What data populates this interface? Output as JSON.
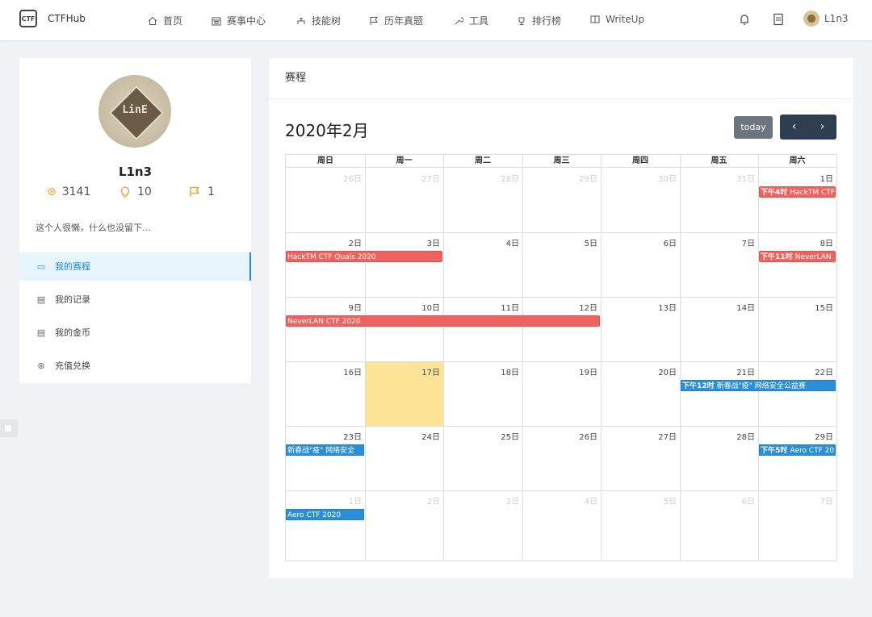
{
  "nav": {
    "brand": "CTFHub",
    "items": [
      {
        "label": "首页",
        "icon": "home-icon"
      },
      {
        "label": "赛事中心",
        "icon": "calendar-icon"
      },
      {
        "label": "技能树",
        "icon": "tree-icon"
      },
      {
        "label": "历年真题",
        "icon": "flag-icon"
      },
      {
        "label": "工具",
        "icon": "wrench-icon"
      },
      {
        "label": "排行榜",
        "icon": "trophy-icon"
      },
      {
        "label": "WriteUp",
        "icon": "book-icon"
      }
    ],
    "user_name": "L1n3"
  },
  "profile": {
    "avatar_text": "LinE",
    "name": "L1n3",
    "coins": "3141",
    "hints": "10",
    "flags": "1",
    "bio": "这个人很懒，什么也没留下...",
    "menu": [
      {
        "label": "我的赛程",
        "icon": "calendar-icon",
        "active": true
      },
      {
        "label": "我的记录",
        "icon": "record-icon",
        "active": false
      },
      {
        "label": "我的金币",
        "icon": "coin-record-icon",
        "active": false
      },
      {
        "label": "充值兑换",
        "icon": "exchange-icon",
        "active": false
      }
    ]
  },
  "schedule": {
    "panel_title": "赛程",
    "month_title": "2020年2月",
    "today_label": "today",
    "prev_label": "‹",
    "next_label": "›",
    "weekdays": [
      "周日",
      "周一",
      "周二",
      "周三",
      "周四",
      "周五",
      "周六"
    ],
    "weeks": [
      [
        {
          "d": "26日",
          "o": true
        },
        {
          "d": "27日",
          "o": true
        },
        {
          "d": "28日",
          "o": true
        },
        {
          "d": "29日",
          "o": true
        },
        {
          "d": "30日",
          "o": true
        },
        {
          "d": "31日",
          "o": true
        },
        {
          "d": "1日",
          "o": false
        }
      ],
      [
        {
          "d": "2日",
          "o": false
        },
        {
          "d": "3日",
          "o": false
        },
        {
          "d": "4日",
          "o": false
        },
        {
          "d": "5日",
          "o": false
        },
        {
          "d": "6日",
          "o": false
        },
        {
          "d": "7日",
          "o": false
        },
        {
          "d": "8日",
          "o": false
        }
      ],
      [
        {
          "d": "9日",
          "o": false
        },
        {
          "d": "10日",
          "o": false
        },
        {
          "d": "11日",
          "o": false
        },
        {
          "d": "12日",
          "o": false
        },
        {
          "d": "13日",
          "o": false
        },
        {
          "d": "14日",
          "o": false
        },
        {
          "d": "15日",
          "o": false
        }
      ],
      [
        {
          "d": "16日",
          "o": false
        },
        {
          "d": "17日",
          "o": false,
          "today": true
        },
        {
          "d": "18日",
          "o": false
        },
        {
          "d": "19日",
          "o": false
        },
        {
          "d": "20日",
          "o": false
        },
        {
          "d": "21日",
          "o": false
        },
        {
          "d": "22日",
          "o": false
        }
      ],
      [
        {
          "d": "23日",
          "o": false
        },
        {
          "d": "24日",
          "o": false
        },
        {
          "d": "25日",
          "o": false
        },
        {
          "d": "26日",
          "o": false
        },
        {
          "d": "27日",
          "o": false
        },
        {
          "d": "28日",
          "o": false
        },
        {
          "d": "29日",
          "o": false
        }
      ],
      [
        {
          "d": "1日",
          "o": true
        },
        {
          "d": "2日",
          "o": true
        },
        {
          "d": "3日",
          "o": true
        },
        {
          "d": "4日",
          "o": true
        },
        {
          "d": "5日",
          "o": true
        },
        {
          "d": "6日",
          "o": true
        },
        {
          "d": "7日",
          "o": true
        }
      ]
    ],
    "events": [
      {
        "week": 0,
        "start": 6,
        "end": 6,
        "time": "下午4时",
        "title": "HackTM CTF",
        "color": "red"
      },
      {
        "week": 1,
        "start": 0,
        "end": 1,
        "time": "",
        "title": "HackTM CTF Quals 2020",
        "color": "red"
      },
      {
        "week": 1,
        "start": 6,
        "end": 6,
        "time": "下午11时",
        "title": "NeverLAN",
        "color": "red"
      },
      {
        "week": 2,
        "start": 0,
        "end": 3,
        "time": "",
        "title": "NeverLAN CTF 2020",
        "color": "red"
      },
      {
        "week": 3,
        "start": 5,
        "end": 6,
        "time": "下午12时",
        "title": "新春战\"疫\" 网络安全公益赛",
        "color": "blue"
      },
      {
        "week": 4,
        "start": 0,
        "end": 0,
        "time": "",
        "title": "新春战\"疫\" 网络安全",
        "color": "blue"
      },
      {
        "week": 4,
        "start": 6,
        "end": 6,
        "time": "下午5时",
        "title": "Aero CTF 20",
        "color": "blue"
      },
      {
        "week": 5,
        "start": 0,
        "end": 0,
        "time": "",
        "title": "Aero CTF 2020",
        "color": "blue"
      }
    ],
    "colors": {
      "red": "#f0625f",
      "blue": "#2a8fd6",
      "today": "#fde396"
    }
  }
}
